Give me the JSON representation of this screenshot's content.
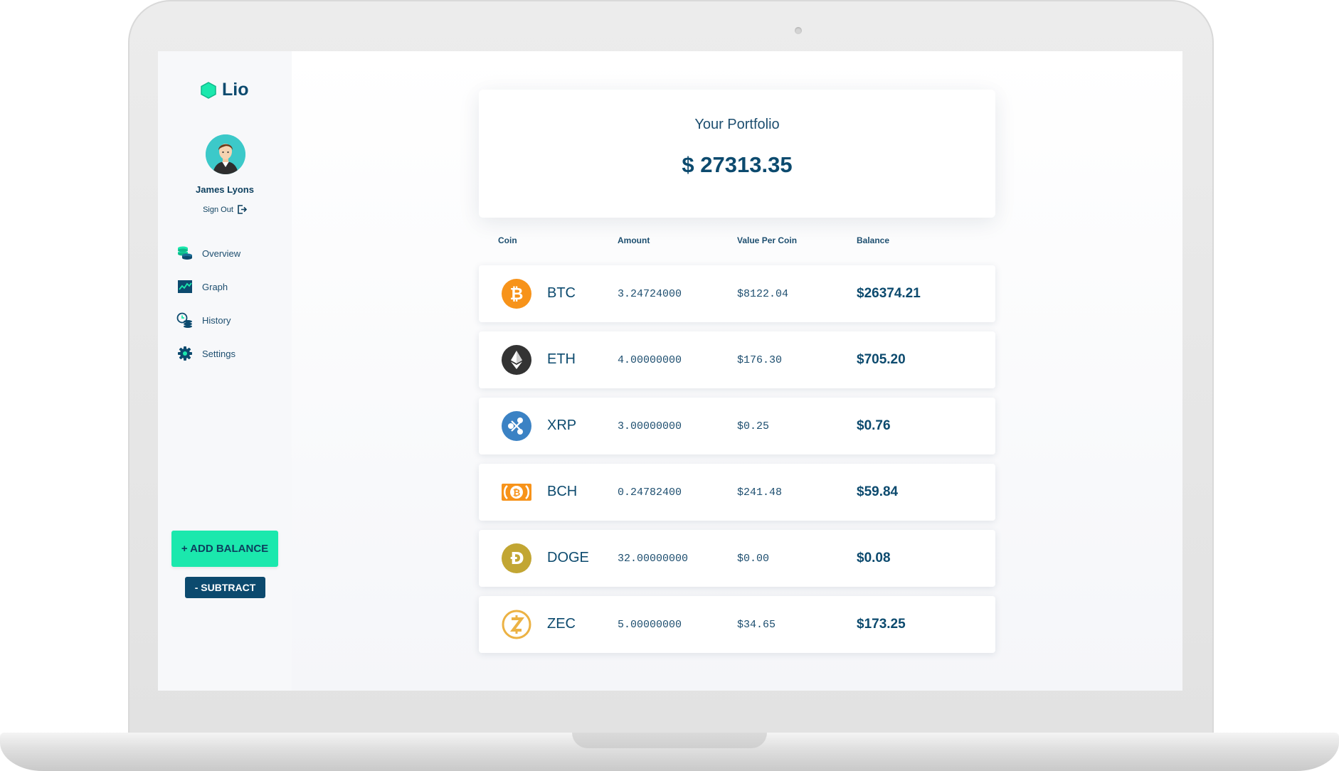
{
  "app": {
    "name": "Lio",
    "accent": "#1be8ad",
    "primary": "#0c4a6e"
  },
  "user": {
    "name": "James Lyons",
    "signout_label": "Sign Out"
  },
  "nav": {
    "items": [
      {
        "label": "Overview",
        "icon": "coins-stack-icon"
      },
      {
        "label": "Graph",
        "icon": "line-graph-icon"
      },
      {
        "label": "History",
        "icon": "coin-history-icon"
      },
      {
        "label": "Settings",
        "icon": "gear-icon"
      }
    ]
  },
  "actions": {
    "add_label": "+ ADD BALANCE",
    "subtract_label": "- SUBTRACT"
  },
  "portfolio": {
    "title": "Your Portfolio",
    "value": "$ 27313.35"
  },
  "table": {
    "headers": [
      "Coin",
      "Amount",
      "Value Per Coin",
      "Balance"
    ],
    "rows": [
      {
        "symbol": "BTC",
        "amount": "3.24724000",
        "value_per_coin": "$8122.04",
        "balance": "$26374.21",
        "icon": "bitcoin-icon",
        "color": "#f7931a"
      },
      {
        "symbol": "ETH",
        "amount": "4.00000000",
        "value_per_coin": "$176.30",
        "balance": "$705.20",
        "icon": "ethereum-icon",
        "color": "#333333"
      },
      {
        "symbol": "XRP",
        "amount": "3.00000000",
        "value_per_coin": "$0.25",
        "balance": "$0.76",
        "icon": "ripple-icon",
        "color": "#3b82c4"
      },
      {
        "symbol": "BCH",
        "amount": "0.24782400",
        "value_per_coin": "$241.48",
        "balance": "$59.84",
        "icon": "bitcoin-cash-icon",
        "color": "#f7931a"
      },
      {
        "symbol": "DOGE",
        "amount": "32.00000000",
        "value_per_coin": "$0.00",
        "balance": "$0.08",
        "icon": "dogecoin-icon",
        "color": "#c2a633"
      },
      {
        "symbol": "ZEC",
        "amount": "5.00000000",
        "value_per_coin": "$34.65",
        "balance": "$173.25",
        "icon": "zcash-icon",
        "color": "#ecb244"
      }
    ]
  }
}
